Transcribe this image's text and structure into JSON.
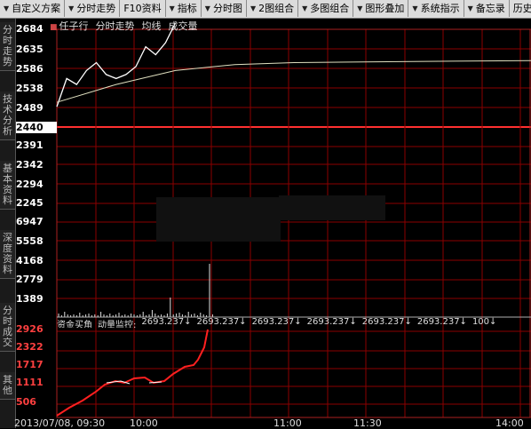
{
  "toolbar": {
    "items": [
      {
        "label": "自定义方案",
        "arrow": "▼"
      },
      {
        "label": "分时走势",
        "arrow": "▼"
      },
      {
        "label": "F10资料",
        "arrow": ""
      },
      {
        "label": "指标",
        "arrow": "▼"
      },
      {
        "label": "分时图",
        "arrow": "▼"
      },
      {
        "label": "2图组合",
        "arrow": "▼"
      },
      {
        "label": "多图组合",
        "arrow": "▼"
      },
      {
        "label": "图形叠加",
        "arrow": "▼"
      },
      {
        "label": "系统指示",
        "arrow": "▼"
      },
      {
        "label": "备忘录",
        "arrow": "▼"
      },
      {
        "label": "历史回",
        "arrow": ""
      }
    ]
  },
  "sidebar": {
    "tabs": [
      "分时走势",
      "技术分析",
      "基本资料",
      "深度资料",
      "分时成交",
      "其他"
    ]
  },
  "legend": {
    "items": [
      "任子行",
      "分时走势",
      "均线",
      "成交量"
    ]
  },
  "price_axis": {
    "labels": [
      "2684",
      "2635",
      "2586",
      "2538",
      "2489",
      "2440",
      "2391",
      "2342",
      "2294",
      "2245"
    ]
  },
  "volume_axis": {
    "labels": [
      "6947",
      "5558",
      "4168",
      "2779",
      "1389"
    ]
  },
  "capital_axis": {
    "labels": [
      "2926",
      "2322",
      "1717",
      "1111",
      "506"
    ]
  },
  "capital_bar": {
    "title": "资金买角",
    "subtitle": "动量监控:",
    "values": [
      "2693.237",
      "2693.237",
      "2693.237",
      "2693.237",
      "2693.237",
      "2693.237",
      "100"
    ]
  },
  "x_axis": {
    "labels": [
      "2013/07/08, 09:30",
      "10:00",
      "11:00",
      "11:30",
      "14:00"
    ]
  },
  "colors": {
    "grid": "#8b0000",
    "price_line": "#ffffff",
    "avg_line": "#e0e0c0",
    "capital_line": "#ff2020",
    "axis_text": "#ffffff"
  },
  "chart_data": {
    "type": "line",
    "series": [
      {
        "name": "分时走势",
        "x": [
          "09:30",
          "09:35",
          "09:40",
          "09:45",
          "09:50",
          "09:55",
          "10:00",
          "10:05",
          "10:10",
          "10:15",
          "10:20",
          "10:25",
          "10:30"
        ],
        "values": [
          2489,
          2560,
          2545,
          2580,
          2600,
          2570,
          2560,
          2570,
          2590,
          2640,
          2620,
          2650,
          2700
        ]
      },
      {
        "name": "均线",
        "x": [
          "09:30",
          "10:00",
          "10:30",
          "11:00",
          "13:00",
          "14:00",
          "15:00"
        ],
        "values": [
          2500,
          2545,
          2580,
          2595,
          2600,
          2603,
          2605
        ]
      }
    ],
    "ylim": [
      2245,
      2684
    ]
  }
}
